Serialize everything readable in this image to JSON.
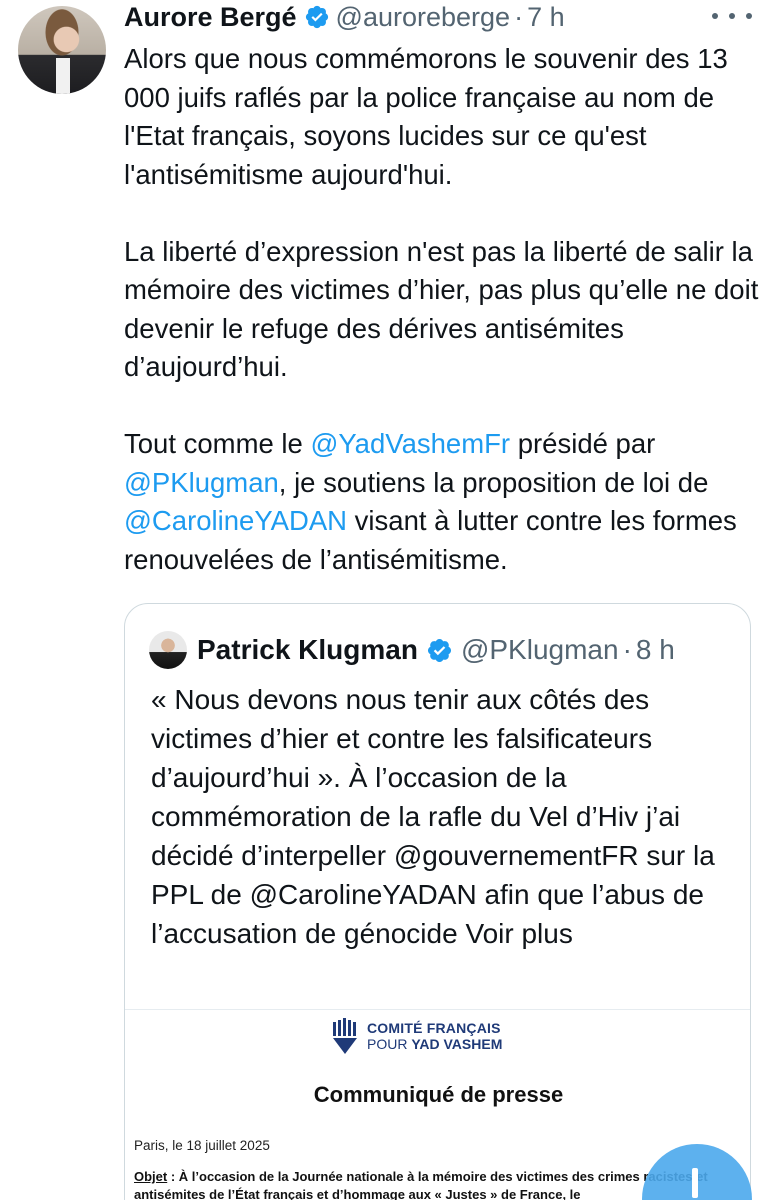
{
  "author": {
    "name": "Aurore Bergé",
    "handle": "@auroreberge",
    "separator": "·",
    "time": "7 h"
  },
  "tweet": {
    "p1": "Alors que nous commémorons le souvenir des 13 000 juifs raflés par la police française au nom de l'Etat français, soyons lucides sur ce qu'est l'antisémitisme aujourd'hui.",
    "p2": "La liberté d’expression n'est pas la liberté de salir la mémoire des victimes d’hier, pas plus qu’elle ne doit devenir le refuge des dérives antisémites d’aujourd’hui.",
    "p3_a": "Tout comme le ",
    "p3_m1": "@YadVashemFr",
    "p3_b": " présidé par ",
    "p3_m2": "@PKlugman",
    "p3_c": ", je soutiens la proposition de loi de ",
    "p3_m3": "@CarolineYADAN",
    "p3_d": " visant à lutter contre les formes renouvelées de l’antisémitisme."
  },
  "quote": {
    "name": "Patrick Klugman",
    "handle": "@PKlugman",
    "separator": "·",
    "time": "8 h",
    "text": "« Nous devons nous tenir aux côtés des victimes d’hier et contre les falsificateurs d’aujourd’hui ». À l’occasion de la commémoration de la rafle du Vel d’Hiv j’ai décidé d’interpeller @gouvernementFR  sur la PPL de @CarolineYADAN afin que l’abus de l’accusation de génocide Voir plus"
  },
  "document": {
    "logo_line1": "COMITÉ FRANÇAIS",
    "logo_line2a": "POUR ",
    "logo_line2b": "YAD VASHEM",
    "title": "Communiqué de presse",
    "date": "Paris, le 18 juillet 2025",
    "objet_label": "Objet",
    "objet_text": " : À l’occasion de la Journée nationale à la mémoire des victimes des crimes racistes et antisémites de l’État français et d’hommage aux « Justes » de France, le"
  },
  "colors": {
    "accent": "#1d9bf0",
    "text": "#0f1419",
    "secondary": "#536471",
    "border": "#cfd9de",
    "logo": "#1f3a78"
  },
  "icons": {
    "verified": "verified-badge-icon",
    "more": "more-options-icon",
    "compose": "floating-action-button"
  }
}
